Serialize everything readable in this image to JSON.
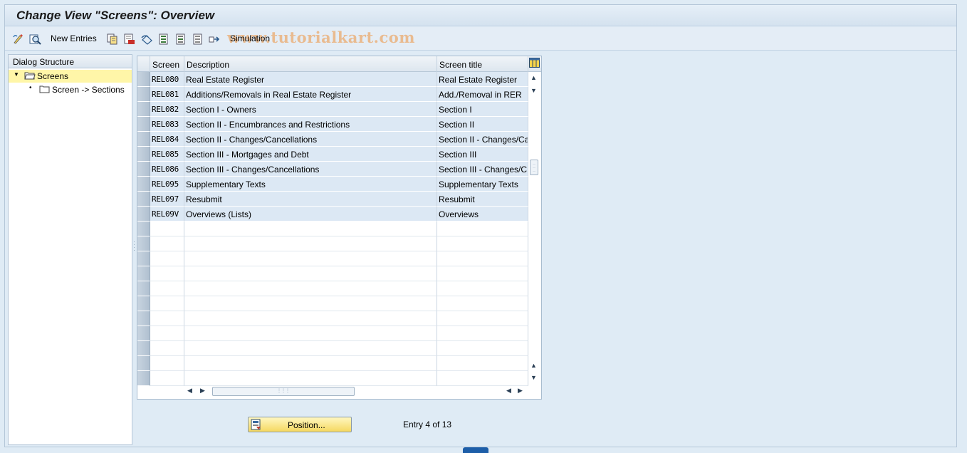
{
  "title": "Change View \"Screens\": Overview",
  "toolbar": {
    "new_entries": "New Entries",
    "simulation": "Simulation",
    "watermark": "www.tutorialkart.com"
  },
  "dialog_structure": {
    "header": "Dialog Structure",
    "items": [
      {
        "label": "Screens",
        "selected": true
      },
      {
        "label": "Screen -> Sections",
        "selected": false
      }
    ]
  },
  "table": {
    "columns": [
      "Screen",
      "Description",
      "Screen title"
    ],
    "rows": [
      {
        "screen": "REL080",
        "description": "Real Estate Register",
        "title": "Real Estate Register"
      },
      {
        "screen": "REL081",
        "description": "Additions/Removals in Real Estate Register",
        "title": "Add./Removal in RER"
      },
      {
        "screen": "REL082",
        "description": "Section I - Owners",
        "title": "Section I"
      },
      {
        "screen": "REL083",
        "description": "Section II - Encumbrances and Restrictions",
        "title": "Section II"
      },
      {
        "screen": "REL084",
        "description": "Section II - Changes/Cancellations",
        "title": "Section II - Changes/Ca"
      },
      {
        "screen": "REL085",
        "description": "Section III - Mortgages and Debt",
        "title": "Section III"
      },
      {
        "screen": "REL086",
        "description": "Section III - Changes/Cancellations",
        "title": "Section III - Changes/C"
      },
      {
        "screen": "REL095",
        "description": "Supplementary Texts",
        "title": "Supplementary Texts"
      },
      {
        "screen": "REL097",
        "description": "Resubmit",
        "title": "Resubmit"
      },
      {
        "screen": "REL09V",
        "description": "Overviews (Lists)",
        "title": "Overviews"
      }
    ],
    "empty_rows": 11
  },
  "position_button": "Position...",
  "entry_info": "Entry 4 of 13",
  "colors": {
    "background": "#dfebf5",
    "row_fill": "#dce8f4",
    "selected_tree": "#fff6a8",
    "button_yellow": "#f5d860"
  }
}
